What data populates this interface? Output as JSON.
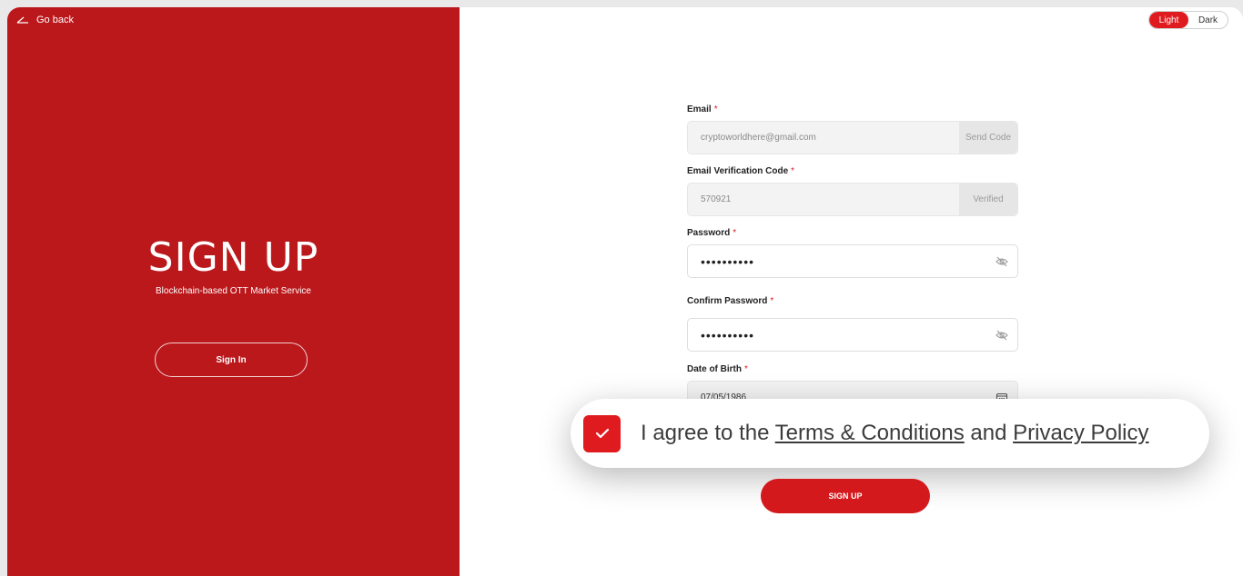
{
  "left_panel": {
    "go_back": "Go back",
    "title": "SIGN UP",
    "subtitle": "Blockchain-based OTT Market Service",
    "sign_in": "Sign In"
  },
  "theme": {
    "light": "Light",
    "dark": "Dark",
    "selected": "Light"
  },
  "form": {
    "email": {
      "label": "Email",
      "required": "*",
      "value": "cryptoworldhere@gmail.com",
      "action": "Send Code"
    },
    "verification": {
      "label": "Email Verification Code",
      "required": "*",
      "value": "570921",
      "status": "Verified"
    },
    "password": {
      "label": "Password",
      "required": "*",
      "value": "••••••••••",
      "icon": "eye-off-icon"
    },
    "confirm_password": {
      "label": "Confirm Password",
      "required": "*",
      "value": "••••••••••",
      "icon": "eye-off-icon"
    },
    "dob": {
      "label": "Date of Birth",
      "required": "*",
      "value": "07/05/1986",
      "icon": "calendar-icon"
    }
  },
  "agreement": {
    "checked": true,
    "prefix": "I agree to the ",
    "terms": "Terms & Conditions",
    "middle": " and ",
    "privacy": "Privacy Policy"
  },
  "submit": {
    "label": "SIGN UP"
  },
  "colors": {
    "brand_red": "#bb181c",
    "accent_red": "#e01b1f",
    "button_red": "#d4191d"
  }
}
